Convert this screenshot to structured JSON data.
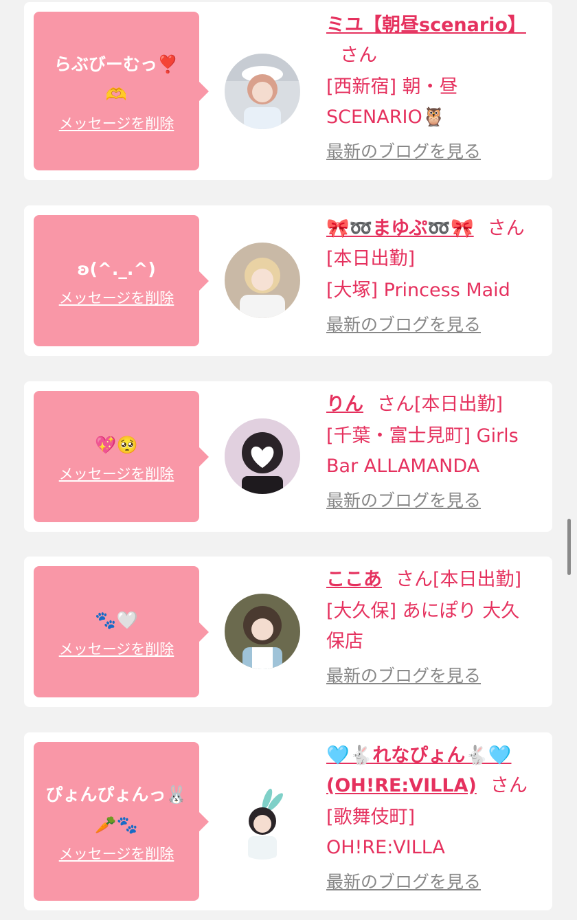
{
  "cards": [
    {
      "message": "らぶびーむっ❣️\n🫶",
      "delete_label": "メッセージを削除",
      "name": "ミユ【朝昼scenario】",
      "honorific": "さん",
      "status": "",
      "place": "[西新宿] 朝・昼SCENARIO🦉",
      "blog_label": "最新のブログを見る"
    },
    {
      "message": "ʚ(^._.^)",
      "delete_label": "メッセージを削除",
      "name": "🎀➿まゆぷ➿🎀",
      "honorific": "さん",
      "status": "[本日出勤]",
      "place": "[大塚] Princess Maid",
      "blog_label": "最新のブログを見る"
    },
    {
      "message": "💖🥺",
      "delete_label": "メッセージを削除",
      "name": "りん",
      "honorific": "さん",
      "status": "[本日出勤]",
      "place": "[千葉・富士見町] Girls Bar ALLAMANDA",
      "blog_label": "最新のブログを見る"
    },
    {
      "message": "🐾🤍",
      "delete_label": "メッセージを削除",
      "name": "ここあ",
      "honorific": "さん",
      "status": "[本日出勤]",
      "place": "[大久保] あにぽり 大久保店",
      "blog_label": "最新のブログを見る"
    },
    {
      "message": "ぴょんぴょんっ🐰\n🥕🐾",
      "delete_label": "メッセージを削除",
      "name": "🩵🐇れなぴょん🐇🩵(OH!RE:VILLA)",
      "honorific": "さん",
      "status": "",
      "place": "[歌舞伎町] OH!RE:VILLA",
      "blog_label": "最新のブログを見る"
    }
  ],
  "colors": {
    "bubble": "#f997a7",
    "accent": "#e5315e",
    "link_gray": "#888888",
    "background": "#f2f2f2"
  }
}
